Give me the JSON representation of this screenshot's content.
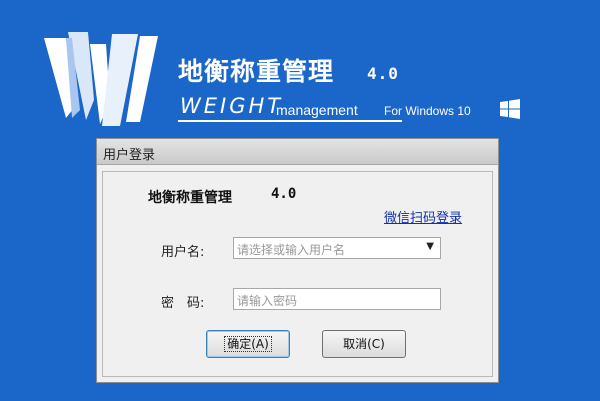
{
  "banner": {
    "title": "地衡称重管理",
    "version": "4.0",
    "brand": "WEIGHT",
    "subtitle": "management",
    "platform": "For Windows 10",
    "logo_icon": "w-logo",
    "os_icon": "windows-icon"
  },
  "dialog": {
    "title": "用户登录",
    "app_name": "地衡称重管理",
    "app_version": "4.0",
    "wechat_link": "微信扫码登录",
    "username_label": "用户名:",
    "username_placeholder": "请选择或输入用户名",
    "password_label": "密　码:",
    "password_placeholder": "请输入密码",
    "ok_button": "确定(A)",
    "cancel_button": "取消(C)"
  },
  "colors": {
    "background": "#1a66c9",
    "link": "#1030b0"
  }
}
